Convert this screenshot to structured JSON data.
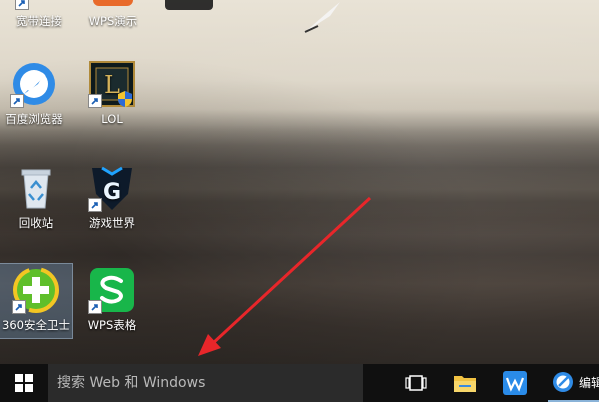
{
  "desktop": {
    "icons": [
      {
        "label": "宽带连接"
      },
      {
        "label": "WPS演示"
      },
      {
        "label": "百度浏览器"
      },
      {
        "label": "LOL"
      },
      {
        "label": "回收站"
      },
      {
        "label": "游戏世界"
      },
      {
        "label": "360安全卫士"
      },
      {
        "label": "WPS表格"
      }
    ]
  },
  "taskbar": {
    "search_placeholder": "搜索 Web 和 Windows",
    "pinned": [
      {
        "icon": "task-view-icon"
      },
      {
        "icon": "file-explorer-icon"
      },
      {
        "icon": "wps-icon"
      },
      {
        "icon": "baidu-browser-icon",
        "label": "编辑"
      }
    ]
  },
  "annotation": {
    "arrow_color": "#e8262a"
  }
}
